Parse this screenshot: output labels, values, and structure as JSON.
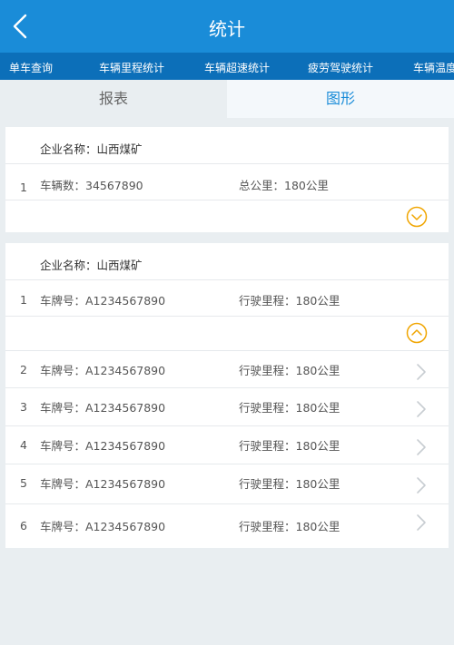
{
  "header": {
    "title": "统计"
  },
  "nav": {
    "items": [
      "单车查询",
      "车辆里程统计",
      "车辆超速统计",
      "疲劳驾驶统计",
      "车辆温度"
    ]
  },
  "tabs": {
    "report": "报表",
    "graph": "图形"
  },
  "summary_card": {
    "company_label": "企业名称：山西煤矿",
    "row": {
      "index": "1",
      "vehicles": "车辆数：34567890",
      "total": "总公里：180公里"
    }
  },
  "detail_card": {
    "company_label": "企业名称：山西煤矿",
    "rows": [
      {
        "index": "1",
        "plate": "车牌号：A1234567890",
        "mileage": "行驶里程：180公里"
      },
      {
        "index": "2",
        "plate": "车牌号：A1234567890",
        "mileage": "行驶里程：180公里"
      },
      {
        "index": "3",
        "plate": "车牌号：A1234567890",
        "mileage": "行驶里程：180公里"
      },
      {
        "index": "4",
        "plate": "车牌号：A1234567890",
        "mileage": "行驶里程：180公里"
      },
      {
        "index": "5",
        "plate": "车牌号：A1234567890",
        "mileage": "行驶里程：180公里"
      },
      {
        "index": "6",
        "plate": "车牌号：A1234567890",
        "mileage": "行驶里程：180公里"
      }
    ]
  },
  "colors": {
    "header": "#1a8cd8",
    "nav": "#0c6fb9",
    "accent": "#f0a500",
    "chevron": "#c8cdd2"
  },
  "icons": {
    "back": "chevron-left-icon",
    "expand": "chevron-down-circle-icon",
    "collapse": "chevron-up-circle-icon",
    "row": "chevron-right-icon"
  }
}
